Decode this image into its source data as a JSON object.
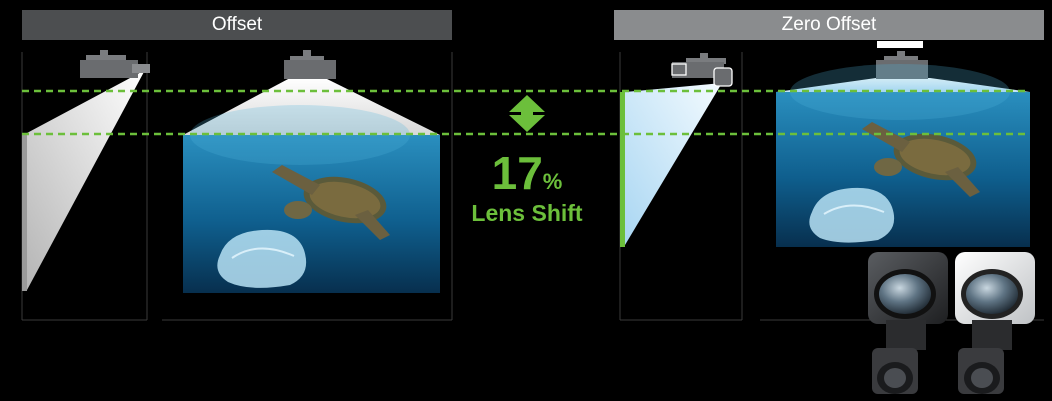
{
  "headers": {
    "offset_label": "Offset",
    "zero_offset_label": "Zero Offset"
  },
  "lens_shift": {
    "value": "17",
    "unit": "%",
    "label": "Lens Shift"
  },
  "colors": {
    "accent_green": "#6cbf3b",
    "header_offset_bg": "#4c4e50",
    "header_zero_bg": "#8a8c8e",
    "beam_white": "#f2f2f2",
    "beam_blue": "#d4ecfa",
    "water_deep": "#0d4f7a",
    "water_light": "#2a8fbf"
  },
  "icons": {
    "projector": "projector-icon",
    "arrow": "up-down-arrow-icon",
    "lens": "lens-product-icon"
  }
}
